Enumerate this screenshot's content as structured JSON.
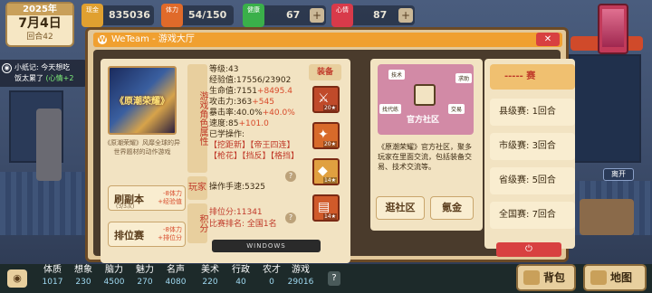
{
  "hud": {
    "year": "2025年",
    "date": "7月4日",
    "turn": "回合42",
    "money": {
      "icon_label": "现金",
      "value": "835036"
    },
    "stamina": {
      "icon_label": "体力",
      "value": "54/150"
    },
    "health": {
      "icon_label": "健康",
      "value": "67"
    },
    "mood": {
      "icon_label": "心情",
      "value": "87"
    },
    "plus": "+"
  },
  "side_note": {
    "title": "小纸记:",
    "text": "今天想吃",
    "line2": "饭太累了",
    "highlight": "(心情+2"
  },
  "dialog": {
    "title": "WeTeam - 游戏大厅",
    "close_icon": "✕",
    "game": {
      "cover_title": "《原潮荣耀》",
      "description": "《原潮荣耀》风靡全球的异世界题材的动作游戏",
      "dungeon_btn": {
        "label": "刷副本",
        "sub": "(3/3次)",
        "cost1": "-8体力",
        "cost2": "+经验值"
      },
      "ranked_btn": {
        "label": "排位赛",
        "cost1": "-8体力",
        "cost2": "+排位分"
      },
      "role_tab": "游戏角色属性",
      "stats": {
        "level": "等级:43",
        "exp": "经验值:17556/23902",
        "hp_base": "生命值:7151",
        "hp_bonus": "+8495.4",
        "atk_base": "攻击力:363",
        "atk_bonus": "+545",
        "crit_base": "暴击率:40.0%",
        "crit_bonus": "+40.0%",
        "spd_base": "速度:85",
        "spd_bonus": "+101.0",
        "skills_label": "已学操作:",
        "skills": [
          "【挖距新】",
          "【帝王四连】",
          "【枪花】",
          "【挡反】",
          "【格挡】"
        ]
      },
      "equip_tab": "装备",
      "equip": [
        {
          "icon": "sword-icon",
          "level": "20★"
        },
        {
          "icon": "fire-icon",
          "level": "20★"
        },
        {
          "icon": "crystal-icon",
          "level": "14★"
        },
        {
          "icon": "book-icon",
          "level": "14★"
        }
      ],
      "player_tab": "玩家",
      "skill_speed": "操作手速:5325",
      "score_tab": "积分",
      "rank_score": "排位分:11341",
      "rank_pos": "比赛排名: 全国1名",
      "help_icon": "?"
    },
    "community": {
      "title": "官方社区",
      "tags": [
        "技术",
        "求助",
        "找代练",
        "交易"
      ],
      "description": "《原潮荣耀》官方社区，聚多玩家在里面交流，包括装备交易、技术交流等。",
      "browse_btn": "逛社区",
      "pay_btn": "氪金"
    },
    "ranking": {
      "header": "----- 赛",
      "rows": [
        {
          "label": "县级赛:",
          "value": "1回合"
        },
        {
          "label": "市级赛:",
          "value": "3回合"
        },
        {
          "label": "省级赛:",
          "value": "5回合"
        },
        {
          "label": "全国赛:",
          "value": "7回合"
        }
      ]
    },
    "windows_label": "WINDOWS",
    "power_icon": "⏻"
  },
  "leave_label": "离开",
  "bottom": {
    "attrs": [
      {
        "name": "体质",
        "value": "1017"
      },
      {
        "name": "想象",
        "value": "230"
      },
      {
        "name": "脑力",
        "value": "4500"
      },
      {
        "name": "魅力",
        "value": "270"
      },
      {
        "name": "名声",
        "value": "4080"
      },
      {
        "name": "美术",
        "value": "220"
      },
      {
        "name": "行政",
        "value": "40"
      },
      {
        "name": "农才",
        "value": "0"
      },
      {
        "name": "游戏",
        "value": "29016"
      }
    ],
    "hint": "?",
    "bag_label": "背包",
    "map_label": "地图"
  },
  "colors": {
    "accent": "#f0a030",
    "danger": "#d84040",
    "panel": "#f2e3c2",
    "frame": "#6b4a26"
  }
}
